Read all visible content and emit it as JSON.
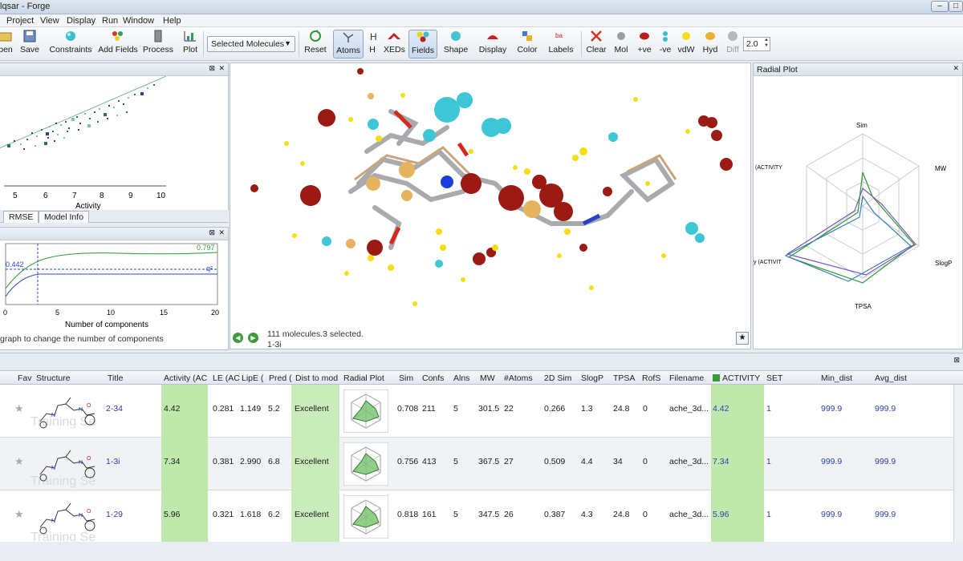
{
  "window": {
    "title": "lqsar - Forge",
    "controls": [
      "–",
      "□"
    ]
  },
  "menu": [
    "Project",
    "View",
    "Display",
    "Run",
    "Window",
    "Help"
  ],
  "toolbar": {
    "left_buttons": [
      {
        "label": "pen",
        "icon": "open-folder-icon"
      },
      {
        "label": "Save",
        "icon": "save-icon"
      },
      {
        "label": "Constraints",
        "icon": "constraints-icon"
      },
      {
        "label": "Add Fields",
        "icon": "add-fields-icon"
      },
      {
        "label": "Process",
        "icon": "process-icon"
      },
      {
        "label": "Plot",
        "icon": "plot-icon"
      }
    ],
    "select_value": "Selected Molecules",
    "right_buttons": [
      {
        "label": "Reset",
        "icon": "reset-icon"
      },
      {
        "label": "Atoms",
        "icon": "atoms-icon"
      },
      {
        "label": "H",
        "icon": "hydrogen-icon"
      },
      {
        "label": "XEDs",
        "icon": "xeds-icon"
      },
      {
        "label": "Fields",
        "icon": "fields-icon"
      },
      {
        "label": "Shape",
        "icon": "shape-icon"
      },
      {
        "label": "Display",
        "icon": "display-icon"
      },
      {
        "label": "Color",
        "icon": "color-icon"
      },
      {
        "label": "Labels",
        "icon": "labels-icon"
      },
      {
        "label": "Clear",
        "icon": "clear-icon"
      },
      {
        "label": "Mol",
        "icon": "mol-icon"
      },
      {
        "label": "+ve",
        "icon": "positive-icon"
      },
      {
        "label": "-ve",
        "icon": "negative-icon"
      },
      {
        "label": "vdW",
        "icon": "vdw-icon"
      },
      {
        "label": "Hyd",
        "icon": "hydrophobic-icon"
      },
      {
        "label": "Diff",
        "icon": "diff-icon"
      }
    ],
    "spin_value": "2.0"
  },
  "scatter_panel": {
    "x_ticks": [
      "5",
      "6",
      "7",
      "8",
      "9",
      "10"
    ],
    "x_label": "Activity",
    "tabs": [
      "RMSE",
      "Model Info"
    ]
  },
  "components_panel": {
    "value_top": "0.797",
    "value_left": "0.442",
    "q_label": "q²",
    "x_ticks": [
      "0",
      "5",
      "10",
      "15",
      "20"
    ],
    "x_label": "Number of components",
    "hint": "graph to change the number of components"
  },
  "viewport": {
    "status_count": "111 molecules.3 selected.",
    "status_sel": "1-3i",
    "star": "★"
  },
  "radial_panel": {
    "title": "Radial Plot",
    "axes": [
      "Sim",
      "MW",
      "SlogP",
      "TPSA",
      "y (ACTIVIT",
      "(ACTIVITY"
    ]
  },
  "table": {
    "headers": [
      "Fav",
      "Structure",
      "Title",
      "Activity (AC",
      "LE (AC",
      "LipE (",
      "Pred (",
      "Dist to mod",
      "Radial Plot",
      "Sim",
      "Confs",
      "Alns",
      "MW",
      "#Atoms",
      "2D Sim",
      "SlogP",
      "TPSA",
      "RofS",
      "Filename",
      "ACTIVITY",
      "SET",
      "Min_dist",
      "Avg_dist"
    ],
    "training_label": "Training Se",
    "rows": [
      {
        "title": "2-34",
        "activity": "4.42",
        "le": "0.281",
        "lipe": "1.149",
        "pred": "5.2",
        "dist": "Excellent",
        "sim": "0.708",
        "confs": "211",
        "alns": "5",
        "mw": "301.5",
        "atoms": "22",
        "sim2d": "0.266",
        "slogp": "1.3",
        "tpsa": "24.8",
        "rofs": "0",
        "file": "ache_3d...",
        "act": "4.42",
        "set": "1",
        "min": "999.9",
        "avg": "999.9"
      },
      {
        "title": "1-3i",
        "activity": "7.34",
        "le": "0.381",
        "lipe": "2.990",
        "pred": "6.8",
        "dist": "Excellent",
        "sim": "0.756",
        "confs": "413",
        "alns": "5",
        "mw": "367.5",
        "atoms": "27",
        "sim2d": "0.509",
        "slogp": "4.4",
        "tpsa": "34",
        "rofs": "0",
        "file": "ache_3d...",
        "act": "7.34",
        "set": "1",
        "min": "999.9",
        "avg": "999.9"
      },
      {
        "title": "1-29",
        "activity": "5.96",
        "le": "0.321",
        "lipe": "1.618",
        "pred": "6.2",
        "dist": "Excellent",
        "sim": "0.818",
        "confs": "161",
        "alns": "5",
        "mw": "347.5",
        "atoms": "26",
        "sim2d": "0.387",
        "slogp": "4.3",
        "tpsa": "24.8",
        "rofs": "0",
        "file": "ache_3d...",
        "act": "5.96",
        "set": "1",
        "min": "999.9",
        "avg": "999.9"
      }
    ]
  }
}
